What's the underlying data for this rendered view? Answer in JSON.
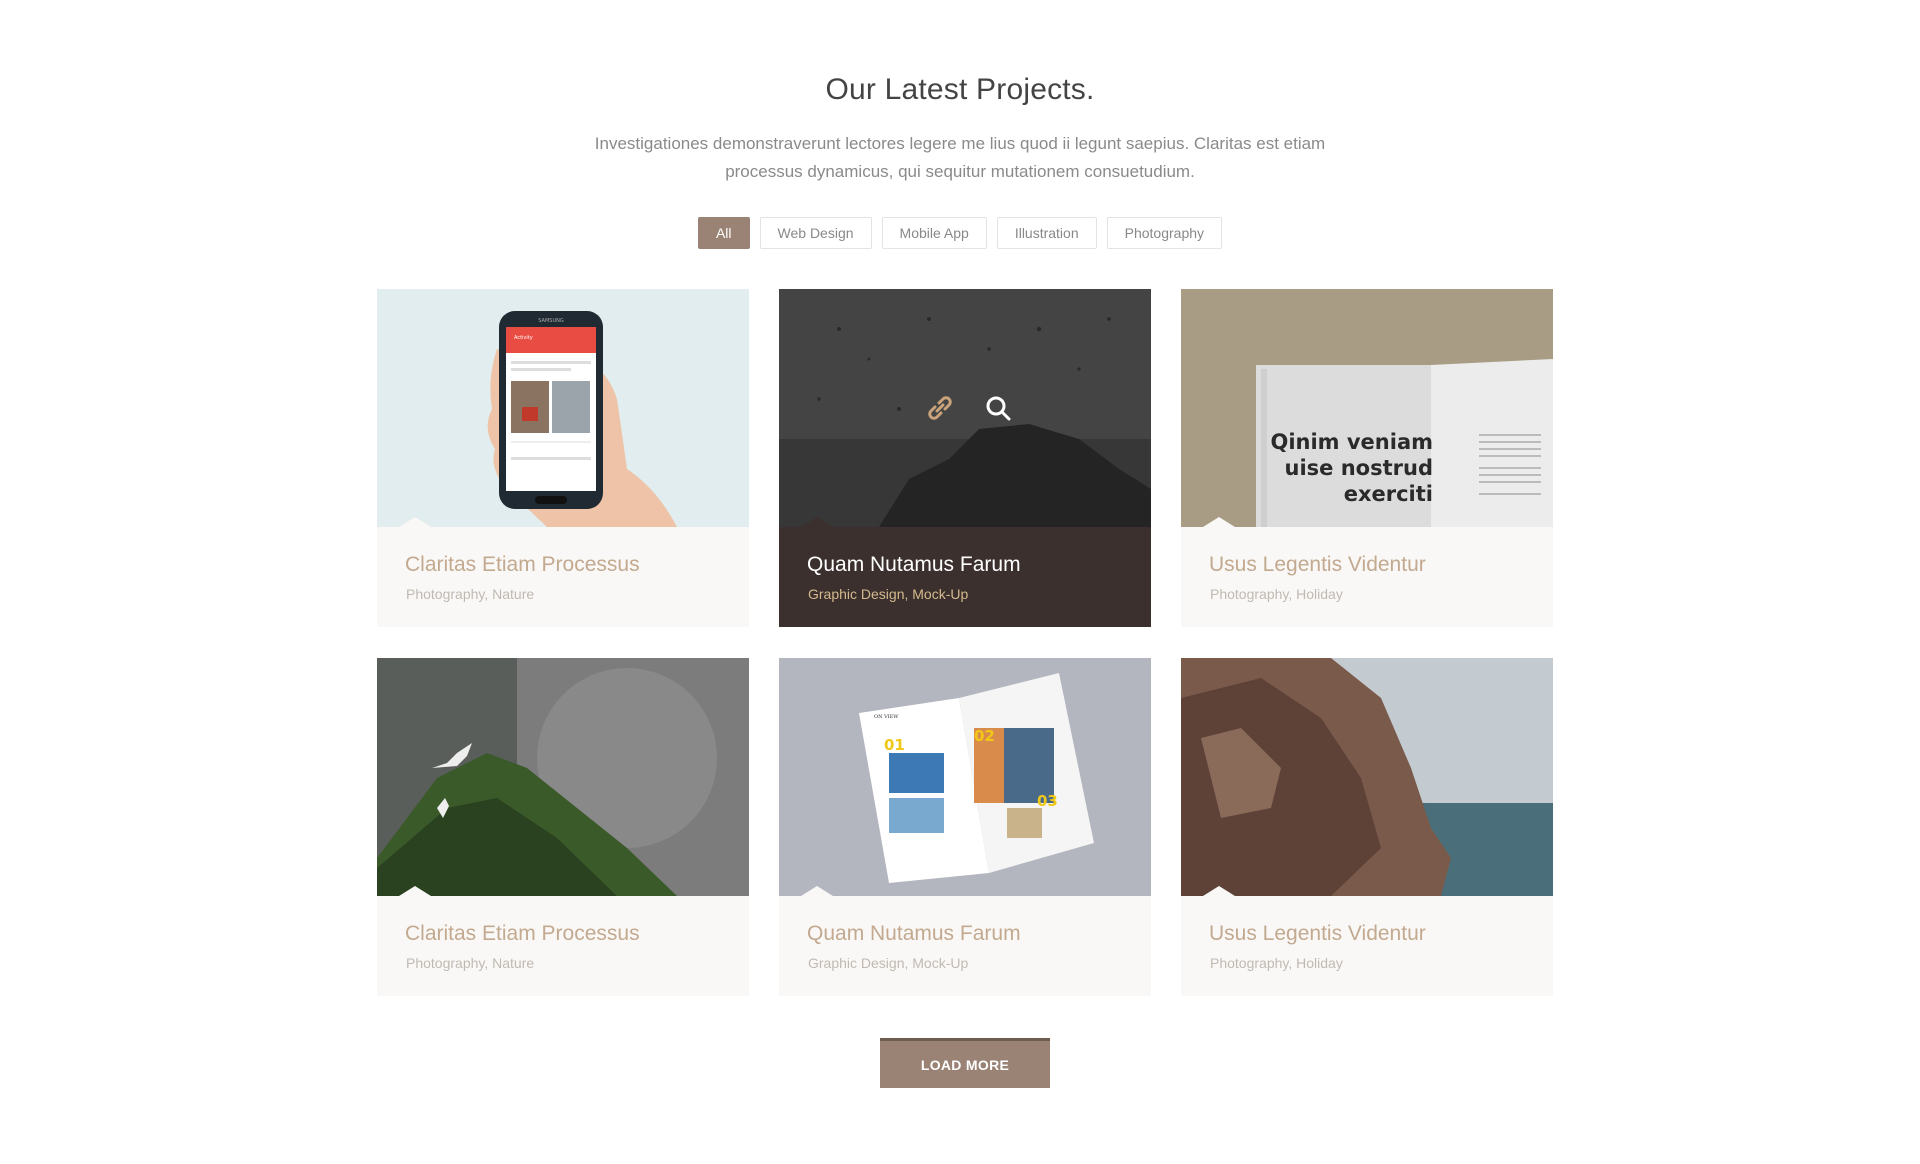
{
  "section": {
    "heading": "Our Latest Projects.",
    "subtitle": "Investigationes demonstraverunt lectores legere me lius quod ii legunt saepius. Claritas est etiam processus dynamicus, qui sequitur mutationem consuetudium."
  },
  "filters": [
    {
      "label": "All",
      "active": true
    },
    {
      "label": "Web Design",
      "active": false
    },
    {
      "label": "Mobile App",
      "active": false
    },
    {
      "label": "Illustration",
      "active": false
    },
    {
      "label": "Photography",
      "active": false
    }
  ],
  "projects": [
    {
      "title": "Claritas Etiam Processus",
      "tags": "Photography, Nature",
      "image": "hand-holding-phone",
      "active": false
    },
    {
      "title": "Quam Nutamus Farum",
      "tags": "Graphic Design, Mock-Up",
      "image": "dark-rock-splash",
      "active": true
    },
    {
      "title": "Usus Legentis Videntur",
      "tags": "Photography, Holiday",
      "image": "open-magazine",
      "active": false,
      "image_text": [
        "Qinim veniam",
        "uise nostrud",
        "exerciti"
      ]
    },
    {
      "title": "Claritas Etiam Processus",
      "tags": "Photography, Nature",
      "image": "seagulls-hill",
      "active": false
    },
    {
      "title": "Quam Nutamus Farum",
      "tags": "Graphic Design, Mock-Up",
      "image": "brochure-mockup",
      "active": false,
      "image_text": [
        "01",
        "02",
        "03",
        "ON VIEW"
      ]
    },
    {
      "title": "Usus Legentis Videntur",
      "tags": "Photography, Holiday",
      "image": "sea-cliff",
      "active": false
    }
  ],
  "phone_text": {
    "brand": "SAMSUNG",
    "app_header": "Activity"
  },
  "load_more": {
    "label": "LOAD MORE"
  },
  "colors": {
    "accent": "#9a8374",
    "card_bg": "#faf8f6",
    "active_card_bg": "#3b302d",
    "title": "#c2a98f"
  }
}
